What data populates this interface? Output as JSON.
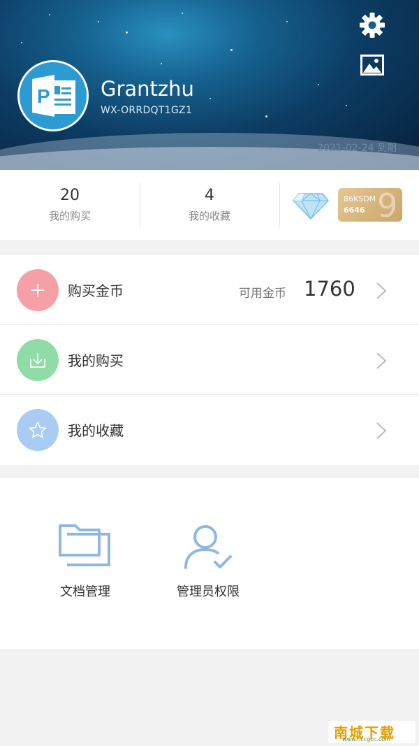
{
  "header": {
    "username": "Grantzhu",
    "user_id": "WX-ORRDQT1GZ1",
    "expiry": "2021-02-24 到期",
    "settings_icon": "gear-icon",
    "background_icon": "image-icon",
    "avatar_icon": "powerpoint-app-icon",
    "colors": {
      "sky_top": "#2a8fbf",
      "sky_bottom": "#071f3a"
    }
  },
  "stats": [
    {
      "value": "20",
      "label": "我的购买"
    },
    {
      "value": "4",
      "label": "我的收藏"
    }
  ],
  "vip": {
    "diamond_icon": "diamond-icon",
    "card_line1": "86KSDM",
    "card_line2": "6646",
    "card_big": "9",
    "card_color": "#d4b07a"
  },
  "menu": {
    "buy_coins": {
      "label": "购买金币",
      "coins_label": "可用金币",
      "coins_value": "1760",
      "icon": "plus-icon",
      "color": "#f5a0a6"
    },
    "my_purchases": {
      "label": "我的购买",
      "icon": "download-icon",
      "color": "#8fdca6"
    },
    "my_favorites": {
      "label": "我的收藏",
      "icon": "star-icon",
      "color": "#a9cdf2"
    }
  },
  "tools": [
    {
      "label": "文档管理",
      "icon": "folder-icon"
    },
    {
      "label": "管理员权限",
      "icon": "admin-user-icon"
    }
  ],
  "watermark": {
    "title": "南城下载",
    "url": "www.nccgcc.com"
  }
}
